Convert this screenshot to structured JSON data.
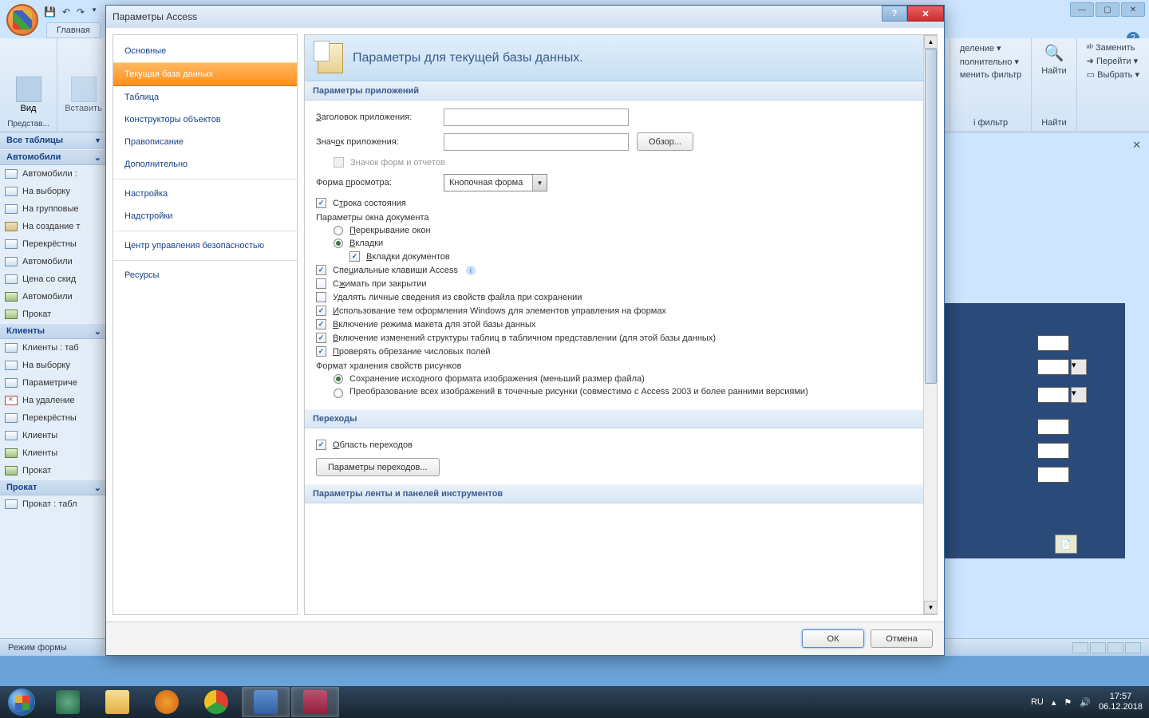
{
  "window": {
    "tab_main": "Главная",
    "help_tooltip": "?"
  },
  "ribbon": {
    "view": "Вид",
    "paste": "Вставить",
    "group_view": "Представ...",
    "right": {
      "selection": "деление ▾",
      "advanced": "полнительно ▾",
      "togglefilter": "менить фильтр",
      "grp_filter": "і фильтр",
      "find": "Найти",
      "replace": "Заменить",
      "goto": "Перейти ▾",
      "select": "Выбрать ▾",
      "grp_find": "Найти"
    }
  },
  "nav": {
    "header": "Все таблицы",
    "cats": [
      {
        "name": "Автомобили",
        "items": [
          {
            "t": "Автомобили :",
            "i": "t"
          },
          {
            "t": "На выборку",
            "i": "t"
          },
          {
            "t": "На групповые",
            "i": "t"
          },
          {
            "t": "На создание т",
            "i": "f"
          },
          {
            "t": "Перекрёстны",
            "i": "t"
          },
          {
            "t": "Автомобили",
            "i": "t"
          },
          {
            "t": "Цена со скид",
            "i": "t"
          },
          {
            "t": "Автомобили",
            "i": "g"
          },
          {
            "t": "Прокат",
            "i": "g"
          }
        ]
      },
      {
        "name": "Клиенты",
        "items": [
          {
            "t": "Клиенты : таб",
            "i": "t"
          },
          {
            "t": "На выборку",
            "i": "t"
          },
          {
            "t": "Параметриче",
            "i": "t"
          },
          {
            "t": "На удаление",
            "i": "r"
          },
          {
            "t": "Перекрёстны",
            "i": "t"
          },
          {
            "t": "Клиенты",
            "i": "t"
          },
          {
            "t": "Клиенты",
            "i": "g"
          },
          {
            "t": "Прокат",
            "i": "g"
          }
        ]
      },
      {
        "name": "Прокат",
        "items": [
          {
            "t": "Прокат : табл",
            "i": "t"
          }
        ]
      }
    ]
  },
  "statusbar": "Режим формы",
  "dialog": {
    "title": "Параметры Access",
    "nav": [
      "Основные",
      "Текущая база данных",
      "Таблица",
      "Конструкторы объектов",
      "Правописание",
      "Дополнительно",
      "Настройка",
      "Надстройки",
      "Центр управления безопасностью",
      "Ресурсы"
    ],
    "active_index": 1,
    "banner": "Параметры для текущей базы данных.",
    "sec_app": "Параметры приложений",
    "app": {
      "title_lbl": "Заголовок приложения:",
      "icon_lbl": "Значок приложения:",
      "browse": "Обзор...",
      "iconforms": "Значок форм и отчетов",
      "displayform_lbl": "Форма просмотра:",
      "displayform_val": "Кнопочная форма",
      "statusbar": "Строка состояния",
      "docwin_hdr": "Параметры окна документа",
      "overlap": "Перекрывание окон",
      "tabs": "Вкладки",
      "doctabs": "Вкладки документов",
      "specialkeys": "Специальные клавиши Access",
      "compact": "Сжимать при закрытии",
      "removeinfo": "Удалять личные сведения из свойств файла при сохранении",
      "winthemes": "Использование тем оформления Windows для элементов управления на формах",
      "layoutview": "Включение режима макета для этой базы данных",
      "designchanges": "Включение изменений структуры таблиц в табличном представлении (для этой базы данных)",
      "checktrunc": "Проверять обрезание числовых полей",
      "picfmt_hdr": "Формат хранения свойств рисунков",
      "pic_opt1": "Сохранение исходного формата изображения (меньший размер файла)",
      "pic_opt2": "Преобразование всех изображений в точечные рисунки (совместимо с Access 2003 и более ранними версиями)"
    },
    "sec_nav": "Переходы",
    "navsec": {
      "showpane": "Область переходов",
      "navopts_btn": "Параметры переходов..."
    },
    "sec_ribbon": "Параметры ленты и панелей инструментов",
    "footer": {
      "ok": "ОК",
      "cancel": "Отмена"
    }
  },
  "tray": {
    "lang": "RU",
    "time": "17:57",
    "date": "06.12.2018"
  }
}
